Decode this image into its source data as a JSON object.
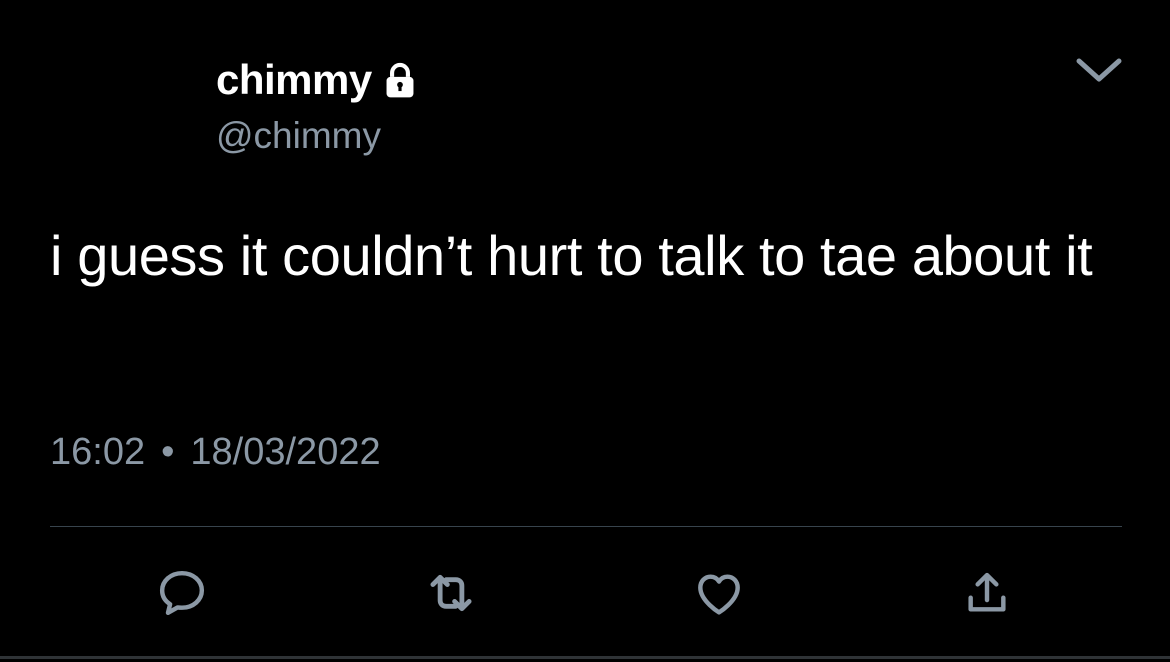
{
  "tweet": {
    "display_name": "chimmy",
    "handle": "@chimmy",
    "text": "i guess it couldn’t hurt to talk to tae about it",
    "time": "16:02",
    "separator": "•",
    "date": "18/03/2022"
  },
  "icons": {
    "lock": "lock-icon",
    "caret": "chevron-down-icon",
    "reply": "reply-icon",
    "retweet": "retweet-icon",
    "like": "heart-icon",
    "share": "share-icon"
  },
  "colors": {
    "background": "#000000",
    "text": "#ffffff",
    "secondary": "#8b98a5",
    "divider": "#38444d"
  }
}
